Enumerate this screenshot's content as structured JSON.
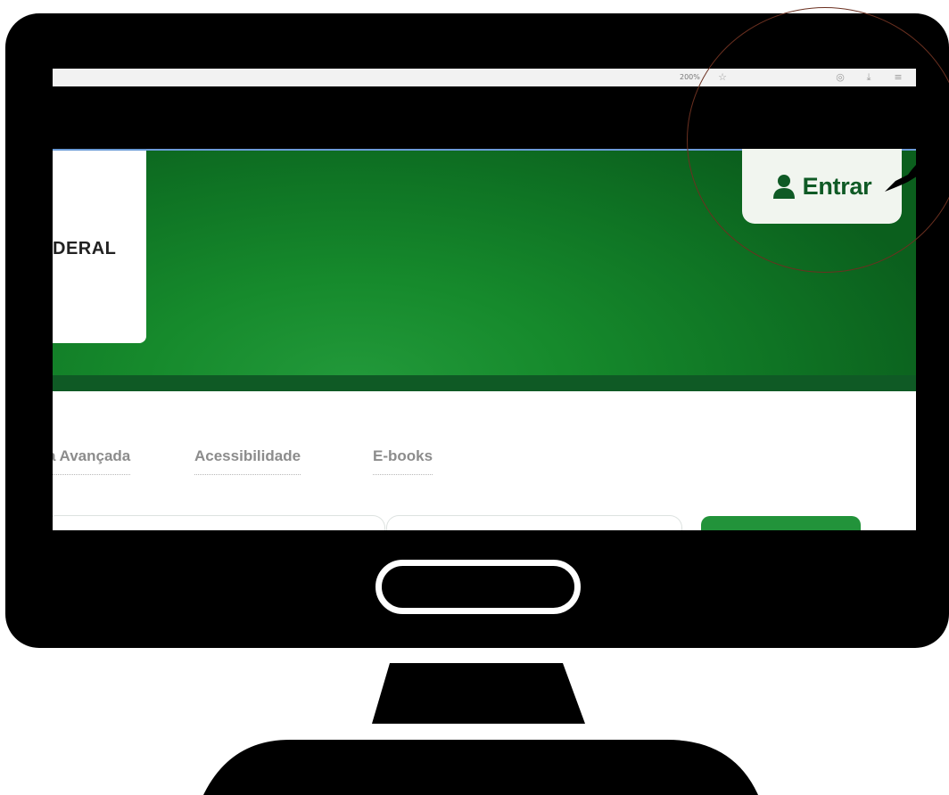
{
  "browser": {
    "zoom": "200%"
  },
  "site": {
    "logo_text": "DERAL",
    "login_label": "Entrar"
  },
  "nav": {
    "items": [
      "a Avançada",
      "Acessibilidade",
      "E-books"
    ]
  },
  "colors": {
    "header_green": "#168a2c",
    "header_stripe": "#0f5a25",
    "login_text": "#0f5a25",
    "search_button": "#22933a",
    "annotation": "#6b3020"
  },
  "icons": {
    "login": "user-icon",
    "browser_bookmark": "bookmark-icon",
    "browser_extension": "extension-icon",
    "browser_download": "download-icon",
    "browser_menu": "menu-icon"
  }
}
